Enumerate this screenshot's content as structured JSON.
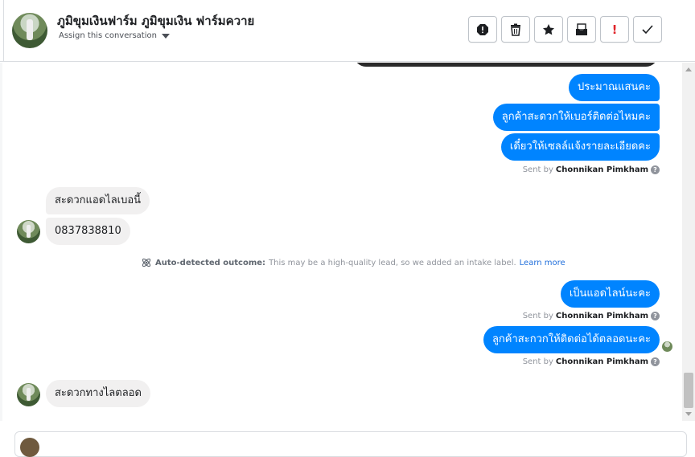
{
  "header": {
    "contact_name": "ภูมิขุมเงินฟาร์ม ภูมิขุมเงิน ฟาร์มควาย",
    "assign_label": "Assign this conversation"
  },
  "toolbar": [
    {
      "name": "spam-icon",
      "glyph": "●",
      "interactable": true
    },
    {
      "name": "trash-icon",
      "glyph": "🗑",
      "interactable": true
    },
    {
      "name": "star-icon",
      "glyph": "★",
      "interactable": true
    },
    {
      "name": "archive-icon",
      "glyph": "✉",
      "interactable": true
    },
    {
      "name": "follow-up-icon",
      "glyph": "!",
      "interactable": true
    },
    {
      "name": "done-icon",
      "glyph": "✓",
      "interactable": true
    }
  ],
  "messages": {
    "m1": "ประมาณแสนคะ",
    "m2": "ลูกค้าสะดวกให้เบอร์ติดต่อไหมคะ",
    "m3": "เดี๋ยวให้เซลล์แจ้งรายละเอียดคะ",
    "sent1_prefix": "Sent by",
    "sent1_name": "Chonnikan Pimkham",
    "in1": "สะดวกแอดไลเบอนี้",
    "in2": "0837838810",
    "outcome_label": "Auto-detected outcome:",
    "outcome_text": "This may be a high-quality lead, so we added an intake label.",
    "outcome_link": "Learn more",
    "m4": "เป็นแอดไลน์นะคะ",
    "sent2_prefix": "Sent by",
    "sent2_name": "Chonnikan Pimkham",
    "m5": "ลูกค้าสะกวกให้ติดต่อได้ตลอดนะคะ",
    "sent3_prefix": "Sent by",
    "sent3_name": "Chonnikan Pimkham",
    "in3": "สะดวกทางไลตลอด"
  },
  "colors": {
    "outgoing_bubble": "#0084ff",
    "incoming_bubble": "#f1f0f0",
    "link": "#216fdb",
    "follow_up_red": "#e0252b"
  }
}
